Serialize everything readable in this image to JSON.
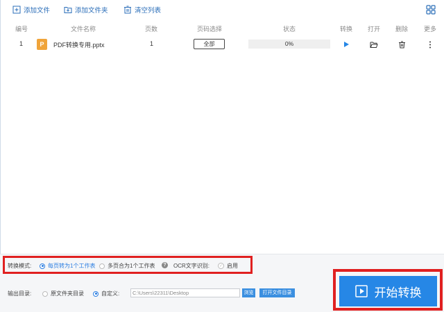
{
  "toolbar": {
    "add_file": "添加文件",
    "add_folder": "添加文件夹",
    "clear_list": "清空列表"
  },
  "table": {
    "headers": {
      "index": "编号",
      "filename": "文件名称",
      "pages": "页数",
      "page_select": "页码选择",
      "status": "状态",
      "convert": "转换",
      "open": "打开",
      "delete": "删除",
      "more": "更多"
    },
    "rows": [
      {
        "index": "1",
        "file_icon_letter": "P",
        "filename": "PDF转换专用.pptx",
        "pages": "1",
        "page_select": "全部",
        "progress_text": "0%",
        "progress_fraction": 0
      }
    ]
  },
  "options": {
    "mode_label": "转换模式:",
    "mode_option_1": "每页转为1个工作表",
    "mode_option_2": "多页合为1个工作表",
    "ocr_label": "OCR文字识别:",
    "ocr_enable": "启用",
    "output_label": "输出目录:",
    "output_option_1": "原文件夹目录",
    "output_option_2": "自定义:",
    "output_path": "C:\\Users\\22311\\Desktop",
    "browse": "浏览",
    "open_folder": "打开文件目录"
  },
  "start_button": "开始转换",
  "colors": {
    "accent": "#2687e6",
    "highlight_box": "#e02020",
    "file_icon": "#f0a43a",
    "link_text": "#2a6db8"
  },
  "icons": [
    "add-file-icon",
    "add-folder-icon",
    "clear-list-icon",
    "grid-view-icon",
    "play-icon",
    "folder-open-icon",
    "trash-icon",
    "more-icon",
    "help-icon",
    "start-play-icon"
  ]
}
